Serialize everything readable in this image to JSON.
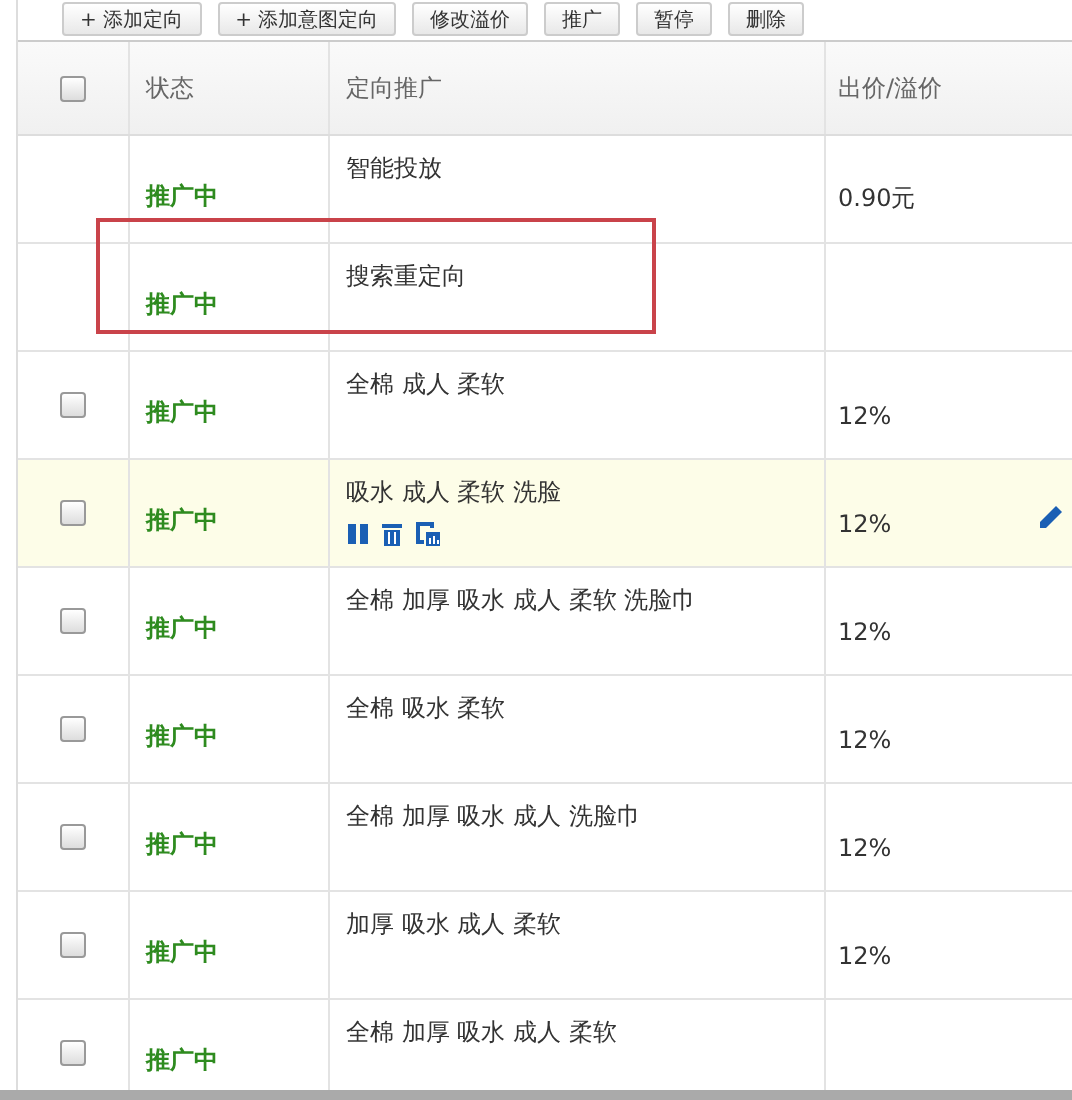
{
  "toolbar": [
    "+ 添加定向",
    "+ 添加意图定向",
    "修改溢价",
    "推广",
    "暂停",
    "删除"
  ],
  "table": {
    "columns": [
      "状态",
      "定向推广",
      "出价/溢价"
    ],
    "header_checked": false,
    "rows": [
      {
        "status": "推广中",
        "target": "智能投放",
        "price": "0.90元",
        "selected": false,
        "outlined": false
      },
      {
        "status": "推广中",
        "target": "搜索重定向",
        "selected": false,
        "outlined": true
      },
      {
        "checked": false,
        "status": "推广中",
        "target": "全棉 成人 柔软",
        "price": "12%",
        "selected": false,
        "outlined": false
      },
      {
        "checked": false,
        "status": "推广中",
        "target": "吸水 成人 柔软 洗脸",
        "price": "12%",
        "selected": true,
        "outlined": false
      },
      {
        "checked": false,
        "status": "推广中",
        "target": "全棉 加厚 吸水 成人 柔软 洗脸巾",
        "price": "12%",
        "selected": false,
        "outlined": false
      },
      {
        "checked": false,
        "status": "推广中",
        "target": "全棉 吸水 柔软",
        "price": "12%",
        "selected": false,
        "outlined": false
      },
      {
        "checked": false,
        "status": "推广中",
        "target": "全棉 加厚 吸水 成人 洗脸巾",
        "price": "12%",
        "selected": false,
        "outlined": false
      },
      {
        "checked": false,
        "status": "推广中",
        "target": "加厚 吸水 成人 柔软",
        "price": "12%",
        "selected": false,
        "outlined": false
      },
      {
        "checked": false,
        "status": "推广中",
        "target": "全棉 加厚 吸水 成人 柔软",
        "selected": false,
        "outlined": false
      }
    ]
  }
}
